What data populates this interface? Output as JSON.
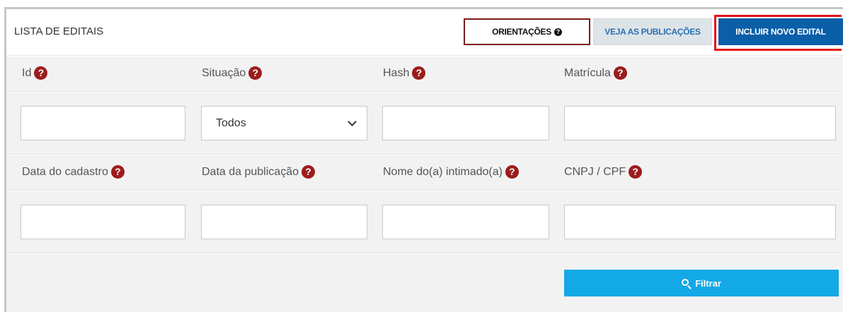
{
  "panel": {
    "title": "LISTA DE EDITAIS"
  },
  "toolbar": {
    "orientacoes_label": "ORIENTAÇÕES",
    "publicacoes_label": "VEJA AS PUBLICAÇÕES",
    "novo_label": "INCLUIR NOVO EDITAL"
  },
  "filters": {
    "row1": [
      {
        "label": "Id",
        "value": ""
      },
      {
        "label": "Situação",
        "value": "Todos",
        "type": "select"
      },
      {
        "label": "Hash",
        "value": ""
      },
      {
        "label": "Matrícula",
        "value": ""
      }
    ],
    "row2": [
      {
        "label": "Data do cadastro",
        "value": ""
      },
      {
        "label": "Data da publicação",
        "value": ""
      },
      {
        "label": "Nome do(a) intimado(a)",
        "value": ""
      },
      {
        "label": "CNPJ / CPF",
        "value": ""
      }
    ],
    "help_glyph": "?",
    "submit_label": "Filtrar"
  },
  "colors": {
    "primary": "#0b5ea8",
    "filter": "#12a9e6",
    "help": "#9c1c1c",
    "highlight": "#e0141c"
  },
  "icons": {
    "help": "question-circle-icon",
    "filter": "search-icon",
    "select": "chevron-down-icon"
  }
}
